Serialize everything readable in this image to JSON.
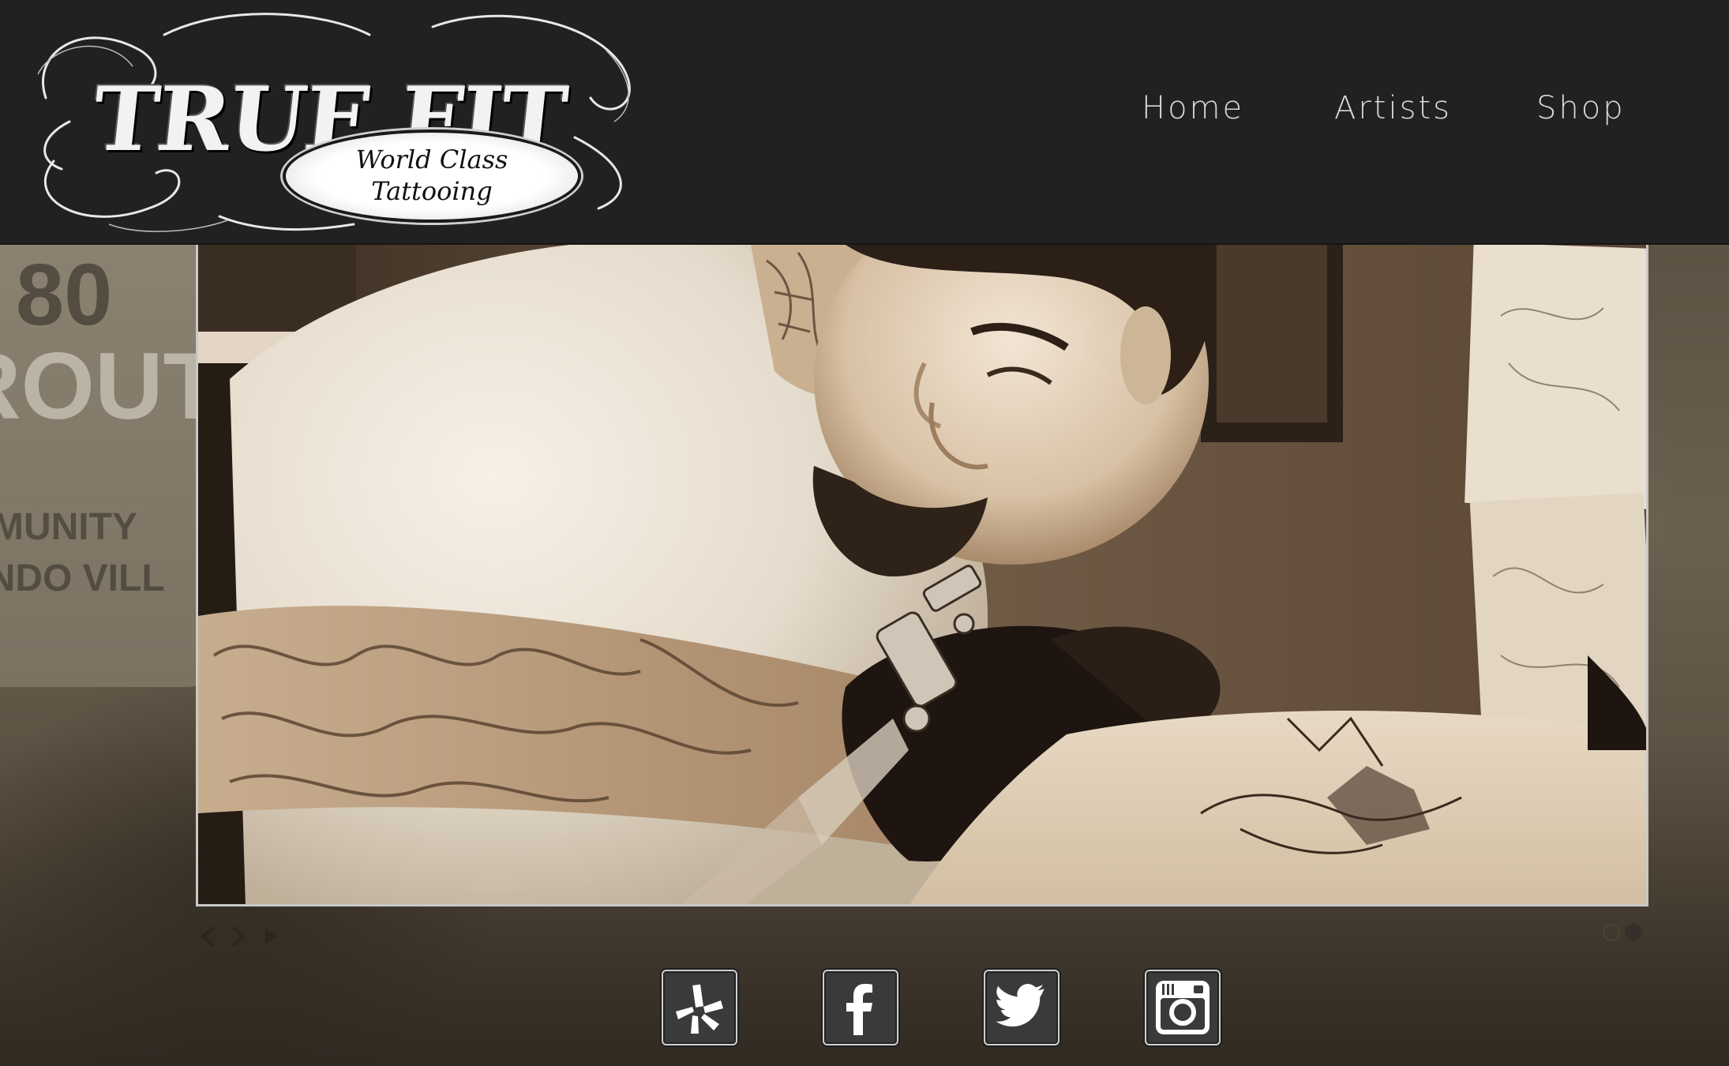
{
  "logo": {
    "wordmark": "TRUE FIT",
    "tagline_line1": "World Class",
    "tagline_line2": "Tattooing"
  },
  "nav": {
    "items": [
      {
        "label": "Home"
      },
      {
        "label": "Artists"
      },
      {
        "label": "Shop"
      }
    ]
  },
  "background": {
    "sign_text_1": "80",
    "sign_text_2": "ROUT",
    "sign_text_3": "MMUNITY",
    "sign_text_4": "ANDO VILL"
  },
  "slideshow": {
    "current_slide": 2,
    "total_slides": 2,
    "image_icon": "photo-icon",
    "controls": [
      "prev-icon",
      "next-icon",
      "play-icon"
    ]
  },
  "social": [
    {
      "name": "Yelp",
      "icon": "yelp-icon"
    },
    {
      "name": "Facebook",
      "icon": "facebook-icon"
    },
    {
      "name": "Twitter",
      "icon": "twitter-icon"
    },
    {
      "name": "Instagram",
      "icon": "instagram-icon"
    }
  ],
  "colors": {
    "header_bg": "#212121",
    "nav_text": "#d8d8d8",
    "icon_bg": "#3a3a3a",
    "sepia_dark": "#2a2118",
    "sepia_light": "#e9e1d3"
  }
}
